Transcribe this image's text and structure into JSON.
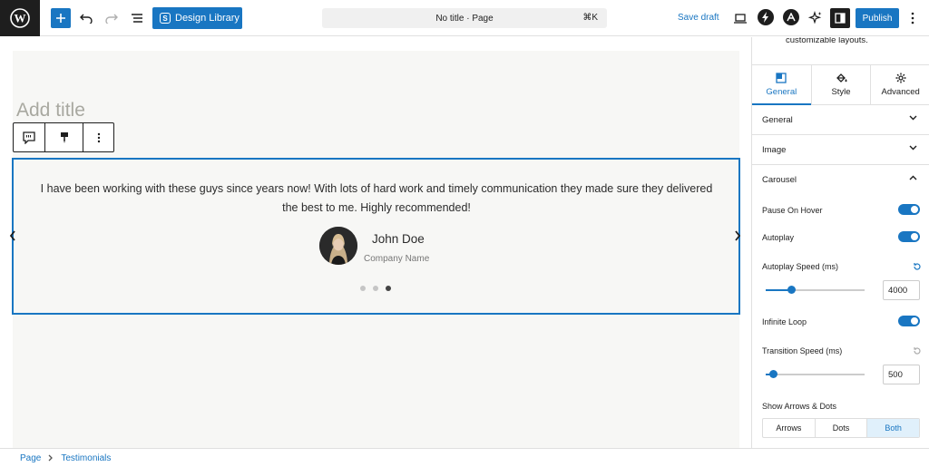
{
  "header": {
    "design_library_label": "Design Library",
    "command_bar_title": "No title · Page",
    "command_shortcut": "⌘K",
    "save_draft_label": "Save draft",
    "publish_label": "Publish"
  },
  "editor": {
    "title_placeholder": "Add title"
  },
  "testimonial": {
    "quote": "I have been working with these guys since years now! With lots of hard work and timely communication they made sure they delivered the best to me. Highly recommended!",
    "author": "John Doe",
    "company": "Company Name",
    "dot_count": 3,
    "active_dot": 3
  },
  "panel": {
    "description": "customizable layouts.",
    "tabs": [
      {
        "label": "General",
        "icon": "general-icon",
        "active": true
      },
      {
        "label": "Style",
        "icon": "paint-bucket-icon",
        "active": false
      },
      {
        "label": "Advanced",
        "icon": "gear-icon",
        "active": false
      }
    ],
    "sections": {
      "general": "General",
      "image": "Image",
      "carousel": "Carousel"
    },
    "carousel": {
      "pause_on_hover_label": "Pause On Hover",
      "pause_on_hover": true,
      "autoplay_label": "Autoplay",
      "autoplay": true,
      "autoplay_speed_label": "Autoplay Speed (ms)",
      "autoplay_speed": "4000",
      "infinite_loop_label": "Infinite Loop",
      "infinite_loop": true,
      "transition_speed_label": "Transition Speed (ms)",
      "transition_speed": "500",
      "show_arrows_dots_label": "Show Arrows & Dots",
      "arrows_dots_options": [
        "Arrows",
        "Dots",
        "Both"
      ],
      "arrows_dots_selected": "Both"
    }
  },
  "footer": {
    "breadcrumb": [
      "Page",
      "Testimonials"
    ]
  },
  "colors": {
    "accent": "#1976c2",
    "dark": "#1e1e1e",
    "canvas": "#f7f7f5"
  }
}
